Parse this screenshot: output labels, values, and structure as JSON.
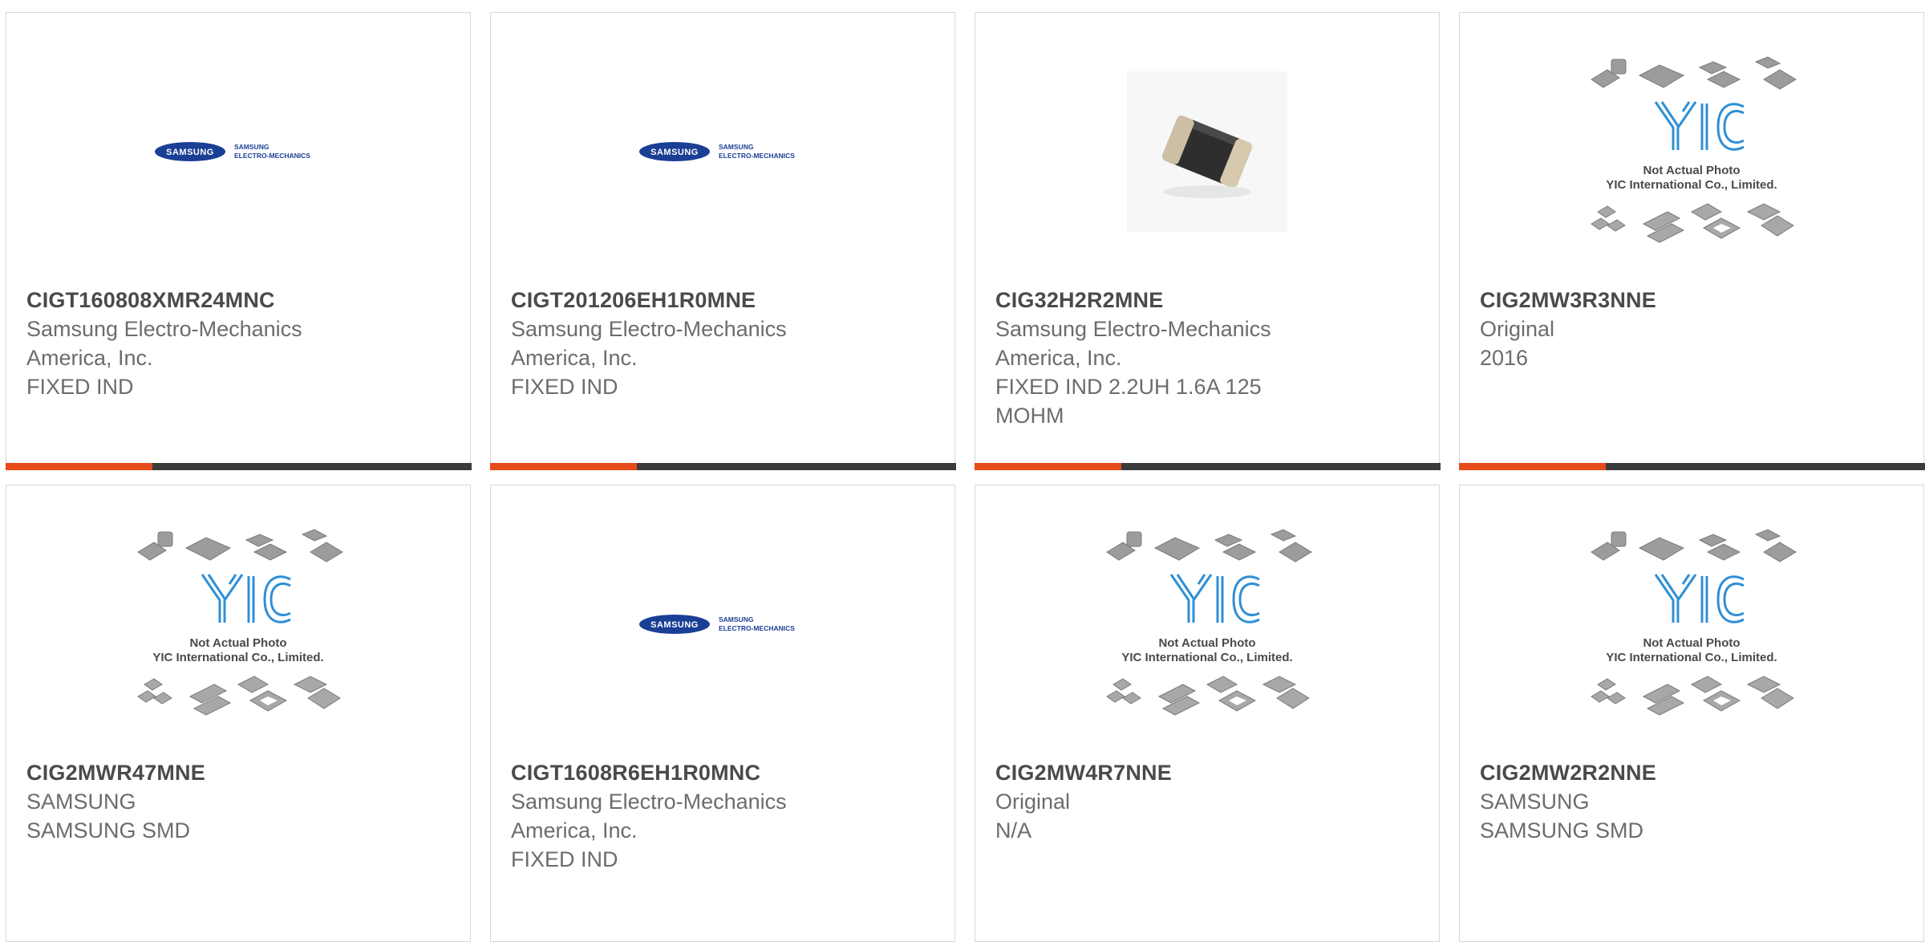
{
  "colors": {
    "accent": "#e64a19",
    "bar": "#3b3b3b",
    "samsung_blue": "#1a3f95",
    "yic_blue": "#2f8fd6"
  },
  "products": [
    {
      "part_number": "CIGT160808XMR24MNC",
      "lines": [
        "Samsung Electro-Mechanics",
        "America, Inc.",
        "FIXED IND"
      ],
      "image": "samsung-logo",
      "has_bar": true
    },
    {
      "part_number": "CIGT201206EH1R0MNE",
      "lines": [
        "Samsung Electro-Mechanics",
        "America, Inc.",
        "FIXED IND"
      ],
      "image": "samsung-logo",
      "has_bar": true
    },
    {
      "part_number": "CIG32H2R2MNE",
      "lines": [
        "Samsung Electro-Mechanics",
        "America, Inc.",
        "FIXED IND 2.2UH 1.6A 125",
        "MOHM"
      ],
      "image": "chip-photo",
      "has_bar": true
    },
    {
      "part_number": "CIG2MW3R3NNE",
      "lines": [
        "Original",
        "2016"
      ],
      "image": "yic-placeholder",
      "has_bar": true
    },
    {
      "part_number": "CIG2MWR47MNE",
      "lines": [
        "SAMSUNG",
        "SAMSUNG SMD"
      ],
      "image": "yic-placeholder",
      "has_bar": false
    },
    {
      "part_number": "CIGT1608R6EH1R0MNC",
      "lines": [
        "Samsung Electro-Mechanics",
        "America, Inc.",
        "FIXED IND"
      ],
      "image": "samsung-logo",
      "has_bar": false
    },
    {
      "part_number": "CIG2MW4R7NNE",
      "lines": [
        "Original",
        "N/A"
      ],
      "image": "yic-placeholder",
      "has_bar": false
    },
    {
      "part_number": "CIG2MW2R2NNE",
      "lines": [
        "SAMSUNG",
        "SAMSUNG SMD"
      ],
      "image": "yic-placeholder",
      "has_bar": false
    }
  ],
  "logo_text": {
    "samsung_oval": "SAMSUNG",
    "samsung_line1": "SAMSUNG",
    "samsung_line2": "ELECTRO-MECHANICS",
    "yic_mark": "YIC",
    "yic_line1": "Not Actual Photo",
    "yic_line2": "YIC International Co., Limited."
  }
}
